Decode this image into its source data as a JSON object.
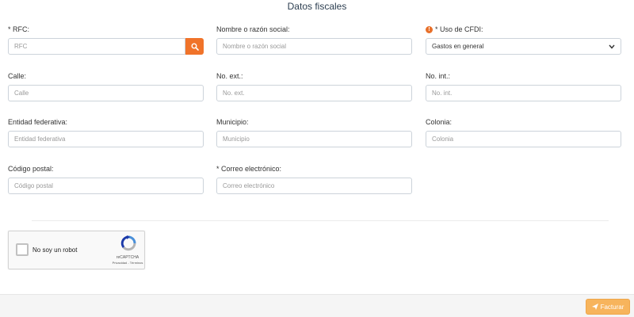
{
  "page_title": "Datos fiscales",
  "fields": {
    "rfc": {
      "label": "* RFC:",
      "placeholder": "RFC"
    },
    "razon_social": {
      "label": "Nombre o razón social:",
      "placeholder": "Nombre o razón social"
    },
    "uso_cfdi": {
      "label": "* Uso de CFDI:",
      "value": "Gastos en general"
    },
    "calle": {
      "label": "Calle:",
      "placeholder": "Calle"
    },
    "no_ext": {
      "label": "No. ext.:",
      "placeholder": "No. ext."
    },
    "no_int": {
      "label": "No. int.:",
      "placeholder": "No. int."
    },
    "entidad": {
      "label": "Entidad federativa:",
      "placeholder": "Entidad federativa"
    },
    "municipio": {
      "label": "Municipio:",
      "placeholder": "Municipio"
    },
    "colonia": {
      "label": "Colonia:",
      "placeholder": "Colonia"
    },
    "codigo_postal": {
      "label": "Código postal:",
      "placeholder": "Código postal"
    },
    "correo": {
      "label": "* Correo electrónico:",
      "placeholder": "Correo electrónico"
    }
  },
  "captcha": {
    "label": "No soy un robot",
    "brand": "reCAPTCHA",
    "terms": "Privacidad - Términos"
  },
  "footer": {
    "submit_label": "Facturar"
  },
  "icons": {
    "search": "search-icon",
    "warning": "exclamation-circle-icon",
    "select_arrow": "chevron-down-icon",
    "send": "paper-plane-icon"
  },
  "colors": {
    "accent_orange": "#f0732a",
    "submit_button": "#f7b45c",
    "title": "#2c3e50"
  }
}
